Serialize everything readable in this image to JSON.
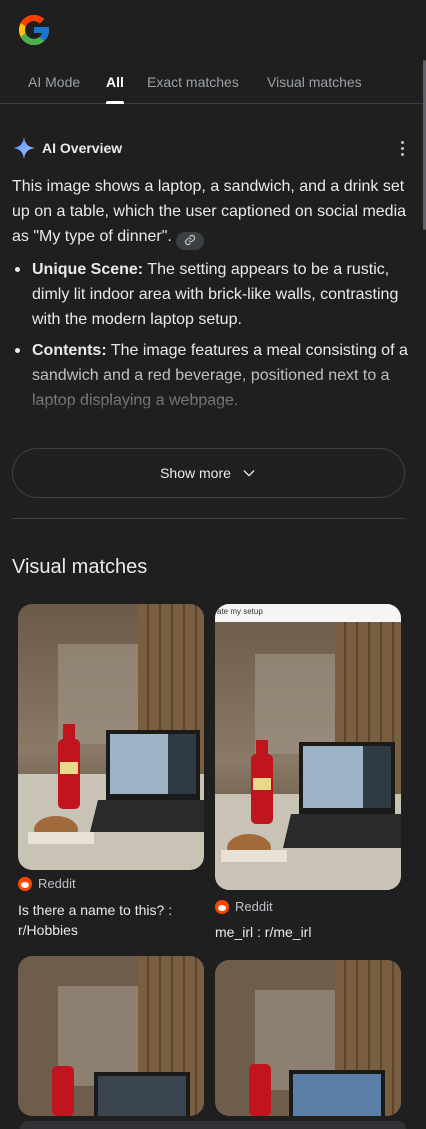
{
  "tabs": [
    {
      "label": "AI Mode"
    },
    {
      "label": "All"
    },
    {
      "label": "Exact matches"
    },
    {
      "label": "Visual matches"
    }
  ],
  "ai_overview": {
    "title": "AI Overview",
    "summary": "This image shows a laptop, a sandwich, and a drink set up on a table, which the user captioned on social media as \"My type of dinner\".",
    "points": [
      {
        "label": "Unique Scene:",
        "text": " The setting appears to be a rustic, dimly lit indoor area with brick-like walls, contrasting with the modern laptop setup."
      },
      {
        "label": "Contents:",
        "text": " The image features a meal consisting of a sandwich and a red beverage, positioned next to a laptop displaying a webpage."
      }
    ],
    "show_more": "Show more"
  },
  "visual_matches": {
    "title": "Visual matches",
    "items": [
      {
        "source": "Reddit",
        "title": "Is there a name to this? : r/Hobbies"
      },
      {
        "source": "Reddit",
        "title": "me_irl : r/me_irl",
        "overlay_caption": "ate my setup"
      },
      {
        "source": "",
        "title": ""
      },
      {
        "source": "",
        "title": ""
      }
    ]
  },
  "colors": {
    "background": "#1f1f1f",
    "text": "#e8eaed",
    "muted": "#9aa0a6",
    "border": "#3c4043",
    "reddit": "#ff4500"
  },
  "icons": [
    "google-logo",
    "sparkle-icon",
    "more-vert-icon",
    "link-icon",
    "chevron-down-icon",
    "reddit-icon"
  ]
}
